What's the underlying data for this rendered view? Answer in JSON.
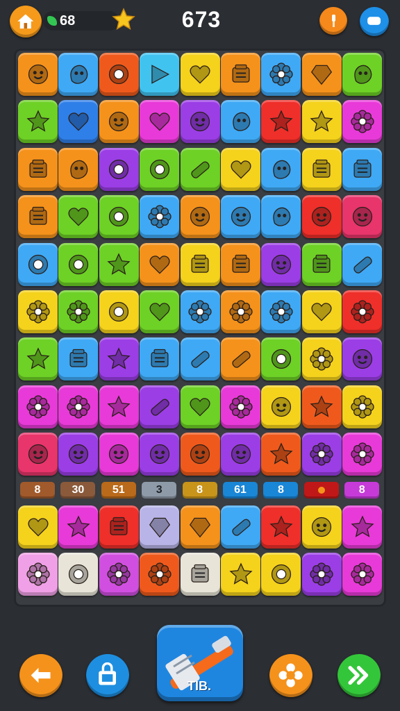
{
  "header": {
    "moves_count": "68",
    "score": "673"
  },
  "board": {
    "tiles": [
      [
        {
          "color": "#f5921b",
          "icon": "flower-face"
        },
        {
          "color": "#3fa9f5",
          "icon": "blob-face"
        },
        {
          "color": "#ef5a1c",
          "icon": "ring"
        },
        {
          "color": "#41c3f0",
          "icon": "triangle"
        },
        {
          "color": "#f5d21c",
          "icon": "heart"
        },
        {
          "color": "#f5921b",
          "icon": "box"
        },
        {
          "color": "#3fa9f5",
          "icon": "flower"
        },
        {
          "color": "#f5921b",
          "icon": "gem"
        },
        {
          "color": "#6ed126",
          "icon": "blob-face"
        }
      ],
      [
        {
          "color": "#6ed126",
          "icon": "star"
        },
        {
          "color": "#2f7fe8",
          "icon": "heart"
        },
        {
          "color": "#f5921b",
          "icon": "flower-face"
        },
        {
          "color": "#e83ad8",
          "icon": "heart"
        },
        {
          "color": "#9b3ee6",
          "icon": "flower-face"
        },
        {
          "color": "#3fa9f5",
          "icon": "blob-face"
        },
        {
          "color": "#ef2f2a",
          "icon": "star"
        },
        {
          "color": "#f5d21c",
          "icon": "star"
        },
        {
          "color": "#e83ad8",
          "icon": "flower"
        }
      ],
      [
        {
          "color": "#f5921b",
          "icon": "box"
        },
        {
          "color": "#f5921b",
          "icon": "blob-face"
        },
        {
          "color": "#9b3ee6",
          "icon": "ring"
        },
        {
          "color": "#6ed126",
          "icon": "ring"
        },
        {
          "color": "#6ed126",
          "icon": "bar"
        },
        {
          "color": "#f5d21c",
          "icon": "heart"
        },
        {
          "color": "#3fa9f5",
          "icon": "blob-face"
        },
        {
          "color": "#f5d21c",
          "icon": "box"
        },
        {
          "color": "#3fa9f5",
          "icon": "box"
        }
      ],
      [
        {
          "color": "#f5921b",
          "icon": "box"
        },
        {
          "color": "#6ed126",
          "icon": "heart"
        },
        {
          "color": "#6ed126",
          "icon": "ring"
        },
        {
          "color": "#3fa9f5",
          "icon": "flower"
        },
        {
          "color": "#f5921b",
          "icon": "flower-face"
        },
        {
          "color": "#3fa9f5",
          "icon": "flower-face"
        },
        {
          "color": "#3fa9f5",
          "icon": "blob-face"
        },
        {
          "color": "#ef2f2a",
          "icon": "flower-face"
        },
        {
          "color": "#e8356b",
          "icon": "flower-face"
        }
      ],
      [
        {
          "color": "#3fa9f5",
          "icon": "ring"
        },
        {
          "color": "#6ed126",
          "icon": "ring"
        },
        {
          "color": "#6ed126",
          "icon": "star"
        },
        {
          "color": "#f5921b",
          "icon": "heart"
        },
        {
          "color": "#f5d21c",
          "icon": "box"
        },
        {
          "color": "#f5921b",
          "icon": "box"
        },
        {
          "color": "#9b3ee6",
          "icon": "flower-face"
        },
        {
          "color": "#6ed126",
          "icon": "box"
        },
        {
          "color": "#3fa9f5",
          "icon": "bar"
        }
      ],
      [
        {
          "color": "#f5d21c",
          "icon": "flower"
        },
        {
          "color": "#6ed126",
          "icon": "flower"
        },
        {
          "color": "#f5d21c",
          "icon": "ring"
        },
        {
          "color": "#6ed126",
          "icon": "heart"
        },
        {
          "color": "#3fa9f5",
          "icon": "flower"
        },
        {
          "color": "#f5921b",
          "icon": "flower"
        },
        {
          "color": "#3fa9f5",
          "icon": "flower"
        },
        {
          "color": "#f5d21c",
          "icon": "heart"
        },
        {
          "color": "#ef2f2a",
          "icon": "flower"
        }
      ],
      [
        {
          "color": "#6ed126",
          "icon": "star"
        },
        {
          "color": "#3fa9f5",
          "icon": "box"
        },
        {
          "color": "#9b3ee6",
          "icon": "star"
        },
        {
          "color": "#3fa9f5",
          "icon": "box"
        },
        {
          "color": "#3fa9f5",
          "icon": "bar"
        },
        {
          "color": "#f5921b",
          "icon": "bar"
        },
        {
          "color": "#6ed126",
          "icon": "ring"
        },
        {
          "color": "#f5d21c",
          "icon": "flower"
        },
        {
          "color": "#9b3ee6",
          "icon": "flower-face"
        }
      ],
      [
        {
          "color": "#e83ad8",
          "icon": "flower"
        },
        {
          "color": "#e83ad8",
          "icon": "flower"
        },
        {
          "color": "#e83ad8",
          "icon": "star"
        },
        {
          "color": "#9b3ee6",
          "icon": "bar"
        },
        {
          "color": "#6ed126",
          "icon": "heart"
        },
        {
          "color": "#e83ad8",
          "icon": "flower"
        },
        {
          "color": "#f5d21c",
          "icon": "flower-face"
        },
        {
          "color": "#ef5a1c",
          "icon": "star"
        },
        {
          "color": "#f5d21c",
          "icon": "flower"
        }
      ],
      [
        {
          "color": "#e8356b",
          "icon": "flower-face"
        },
        {
          "color": "#9b3ee6",
          "icon": "flower-face"
        },
        {
          "color": "#e83ad8",
          "icon": "flower-face"
        },
        {
          "color": "#9b3ee6",
          "icon": "flower-face"
        },
        {
          "color": "#ef5a1c",
          "icon": "flower-face"
        },
        {
          "color": "#9b3ee6",
          "icon": "flower-face"
        },
        {
          "color": "#ef5a1c",
          "icon": "star"
        },
        {
          "color": "#9b3ee6",
          "icon": "flower"
        },
        {
          "color": "#e83ad8",
          "icon": "flower"
        }
      ],
      [
        {
          "color": "#f5d21c",
          "icon": "heart"
        },
        {
          "color": "#e83ad8",
          "icon": "star"
        },
        {
          "color": "#ef2f2a",
          "icon": "box"
        },
        {
          "color": "#b8b4e8",
          "icon": "gem"
        },
        {
          "color": "#f5921b",
          "icon": "gem"
        },
        {
          "color": "#3fa9f5",
          "icon": "bar"
        },
        {
          "color": "#ef2f2a",
          "icon": "star"
        },
        {
          "color": "#f5d21c",
          "icon": "flower-face"
        },
        {
          "color": "#e83ad8",
          "icon": "star"
        }
      ],
      [
        {
          "color": "#f0a0e6",
          "icon": "flower"
        },
        {
          "color": "#e8e4d8",
          "icon": "ring"
        },
        {
          "color": "#d04fe0",
          "icon": "flower"
        },
        {
          "color": "#ef5a1c",
          "icon": "flower"
        },
        {
          "color": "#e8e4d8",
          "icon": "box"
        },
        {
          "color": "#f5d21c",
          "icon": "star"
        },
        {
          "color": "#f5d21c",
          "icon": "ring"
        },
        {
          "color": "#9b3ee6",
          "icon": "flower"
        },
        {
          "color": "#e83ad8",
          "icon": "flower"
        }
      ]
    ],
    "number_row": [
      {
        "text": "8",
        "bg": "#a15a2b",
        "fg": "#ffffff"
      },
      {
        "text": "30",
        "bg": "#8a5a3b",
        "fg": "#ffffff"
      },
      {
        "text": "51",
        "bg": "#b96a1a",
        "fg": "#ffffff"
      },
      {
        "text": "3",
        "bg": "#8e9aa8",
        "fg": "#1f2329"
      },
      {
        "text": "8",
        "bg": "#c8941a",
        "fg": "#ffffff"
      },
      {
        "text": "61",
        "bg": "#1a86d6",
        "fg": "#ffffff"
      },
      {
        "text": "8",
        "bg": "#1a86d6",
        "fg": "#ffffff"
      },
      {
        "text": "",
        "bg": "#c01818",
        "fg": "#f5921b"
      },
      {
        "text": "8",
        "bg": "#c63ad8",
        "fg": "#ffffff"
      }
    ]
  },
  "footer": {
    "powerup_label": "TIB."
  }
}
